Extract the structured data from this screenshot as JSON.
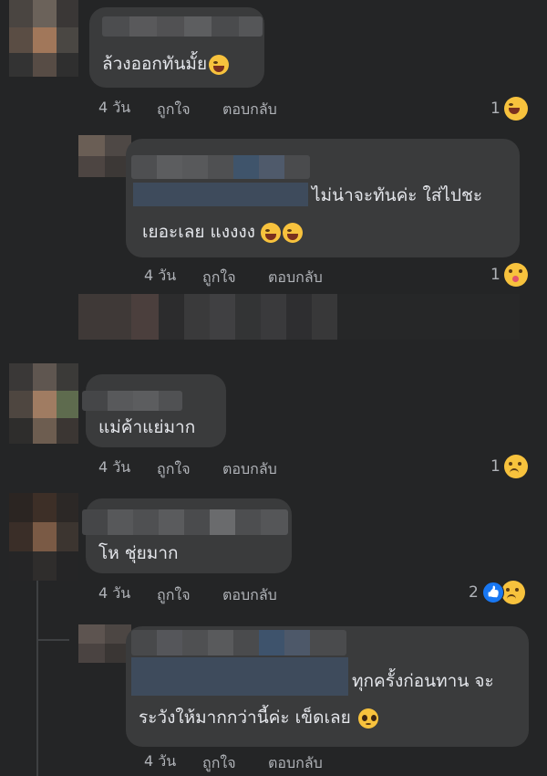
{
  "comments": [
    {
      "text_lines": [
        "ล้วงออกทันมั้ย"
      ],
      "inline_emoji": "tears-of-joy-emoji",
      "time": "4 วัน",
      "like_label": "ถูกใจ",
      "reply_label": "ตอบกลับ",
      "reaction_count": "1",
      "reaction_icon": "squinting-tongue-emoji"
    },
    {
      "text_lines": [
        "ไม่น่าจะทันค่ะ ใส่ไปชะ",
        "เยอะเลย แงงงง"
      ],
      "inline_emoji": "tears-of-joy-emoji",
      "time": "4 วัน",
      "like_label": "ถูกใจ",
      "reply_label": "ตอบกลับ",
      "reaction_count": "1",
      "reaction_icon": "hug-emoji"
    },
    {
      "text_lines": [
        "แม่ค้าแย่มาก"
      ],
      "time": "4 วัน",
      "like_label": "ถูกใจ",
      "reply_label": "ตอบกลับ",
      "reaction_count": "1",
      "reaction_icon": "sad-tear-emoji"
    },
    {
      "text_lines": [
        "โห  ชุ่ยมาก"
      ],
      "time": "4 วัน",
      "like_label": "ถูกใจ",
      "reply_label": "ตอบกลับ",
      "reaction_count": "2",
      "reaction_icon": "like-and-sad-emoji"
    },
    {
      "text_lines": [
        "ทุกครั้งก่อนทาน จะ",
        "ระวังให้มากกว่านี้ค่ะ เข็ดเลย"
      ],
      "inline_emoji": "pleading-face-emoji",
      "time": "4 วัน",
      "like_label": "ถูกใจ",
      "reply_label": "ตอบกลับ"
    }
  ],
  "colors": {
    "background": "#242526",
    "bubble": "#3a3b3c",
    "text": "#e4e6eb",
    "meta": "#b0b3b8",
    "like_blue": "#1877f2"
  }
}
